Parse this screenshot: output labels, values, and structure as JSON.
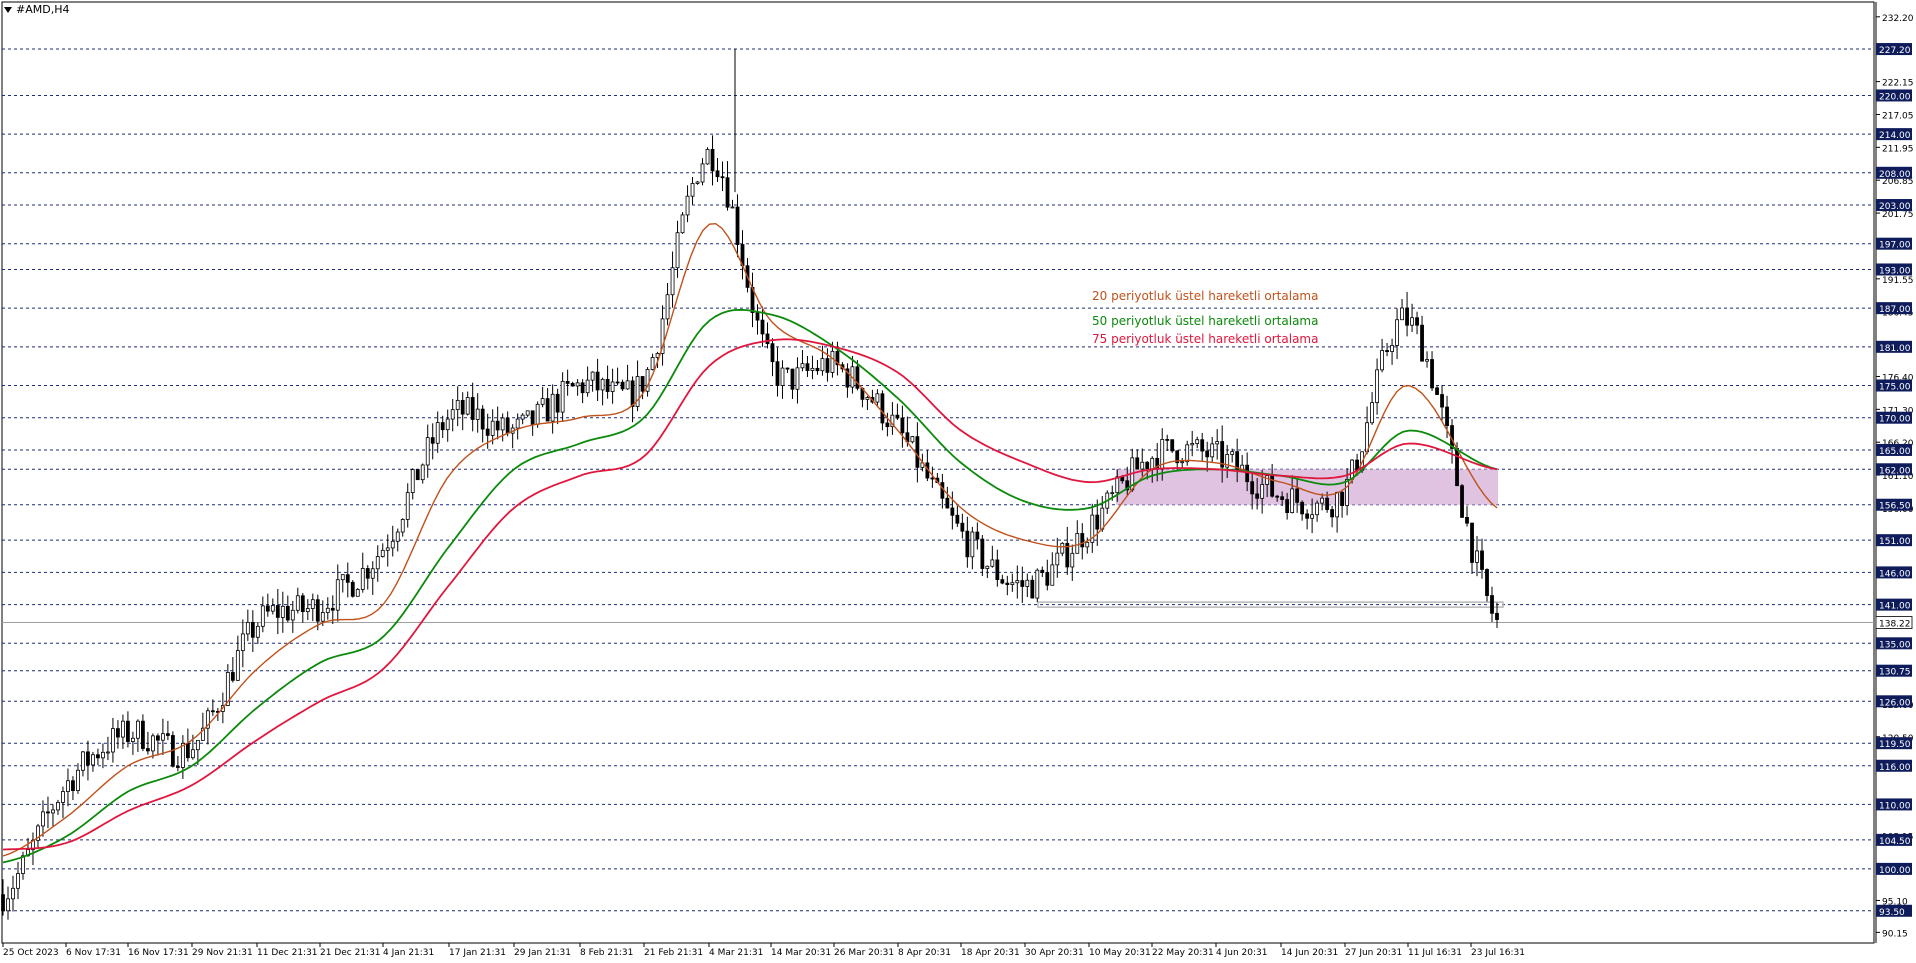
{
  "window": {
    "symbol_title": "#AMD,H4"
  },
  "colors": {
    "background": "#ffffff",
    "grid_level": "#1f2a7a",
    "axis_text": "#000000",
    "label_box": "#0f1c5c",
    "label_text": "#ffffff",
    "candle": "#000000",
    "ema20": "#c0521c",
    "ema50": "#0b8a0b",
    "ema75": "#e0163c",
    "zone_fill": "#d9b9dc",
    "support_line": "#b8b8b8",
    "current_price_line": "#a0a0a0"
  },
  "chart_data": {
    "type": "candlestick",
    "title": "#AMD,H4",
    "ylim": [
      88.5,
      234.5
    ],
    "grid": false,
    "annotations": [
      {
        "text": "20 periyotluk üstel hareketli ortalama",
        "color": "#c0521c"
      },
      {
        "text": "50 periyotluk üstel hareketli ortalama",
        "color": "#0b8a0b"
      },
      {
        "text": "75 periyotluk üstel hareketli ortalama",
        "color": "#e0163c"
      }
    ],
    "x_ticks": [
      "25 Oct 2023",
      "6 Nov 17:31",
      "16 Nov 17:31",
      "29 Nov 21:31",
      "11 Dec 21:31",
      "21 Dec 21:31",
      "4 Jan 21:31",
      "17 Jan 21:31",
      "29 Jan 21:31",
      "8 Feb 21:31",
      "21 Feb 21:31",
      "4 Mar 21:31",
      "14 Mar 20:31",
      "26 Mar 20:31",
      "8 Apr 20:31",
      "18 Apr 20:31",
      "30 Apr 20:31",
      "10 May 20:31",
      "22 May 20:31",
      "4 Jun 20:31",
      "14 Jun 20:31",
      "27 Jun 20:31",
      "11 Jul 16:31",
      "23 Jul 16:31"
    ],
    "y_axis_ticks": [
      "232.20",
      "222.15",
      "217.05",
      "211.95",
      "206.85",
      "201.75",
      "191.55",
      "186.45",
      "176.40",
      "171.30",
      "166.20",
      "161.10",
      "156.00",
      "125.60",
      "120.50",
      "105.15",
      "95.10",
      "90.15"
    ],
    "horizontal_levels": [
      "227.20",
      "220.00",
      "214.00",
      "208.00",
      "203.00",
      "197.00",
      "193.00",
      "187.00",
      "181.00",
      "175.00",
      "170.00",
      "165.00",
      "162.00",
      "156.50",
      "151.00",
      "146.00",
      "141.00",
      "135.00",
      "130.75",
      "126.00",
      "119.50",
      "116.00",
      "110.00",
      "104.50",
      "100.00",
      "93.50"
    ],
    "current_price": "138.22",
    "zone": {
      "from_date": "10 May 20:31",
      "to_date": "23 Jul 16:31",
      "low": 156.5,
      "high": 162.0
    },
    "support_line": {
      "from_date": "30 Apr 20:31",
      "to_date": "23 Jul 16:31",
      "value": 141.0
    },
    "series": [
      {
        "kind": "close",
        "x": [
          "25 Oct 2023",
          "6 Nov 17:31",
          "16 Nov 17:31",
          "29 Nov 21:31",
          "11 Dec 21:31",
          "21 Dec 21:31",
          "4 Jan 21:31",
          "17 Jan 21:31",
          "29 Jan 21:31",
          "8 Feb 21:31",
          "21 Feb 21:31",
          "4 Mar 21:31",
          "14 Mar 20:31",
          "26 Mar 20:31",
          "8 Apr 20:31",
          "18 Apr 20:31",
          "30 Apr 20:31",
          "10 May 20:31",
          "22 May 20:31",
          "4 Jun 20:31",
          "14 Jun 20:31",
          "27 Jun 20:31",
          "11 Jul 16:31",
          "23 Jul 16:31"
        ],
        "values": [
          96,
          113,
          121,
          119,
          138,
          141,
          150,
          170,
          168,
          175,
          176,
          211,
          178,
          178,
          168,
          152,
          144,
          153,
          164,
          164,
          158,
          159,
          185,
          138.22
        ]
      },
      {
        "name": "20 periyotluk üstel hareketli ortalama",
        "values": [
          102,
          108,
          116,
          120,
          131,
          138,
          141,
          161,
          168,
          170,
          174,
          200,
          185,
          179,
          168,
          156,
          151,
          151,
          162,
          163,
          160,
          159,
          175,
          156
        ]
      },
      {
        "name": "50 periyotluk üstel hareketli ortalama",
        "values": [
          101,
          105,
          112,
          116,
          125,
          132,
          136,
          150,
          162,
          166,
          170,
          185,
          186,
          181,
          173,
          163,
          157,
          156,
          161,
          162,
          161,
          160,
          168,
          162
        ]
      },
      {
        "name": "75 periyotluk üstel hareketli ortalama",
        "values": [
          103,
          104,
          109,
          113,
          120,
          126,
          131,
          144,
          156,
          161,
          164,
          178,
          182,
          181,
          177,
          168,
          163,
          160,
          162,
          162,
          161,
          161,
          166,
          162
        ]
      }
    ]
  }
}
